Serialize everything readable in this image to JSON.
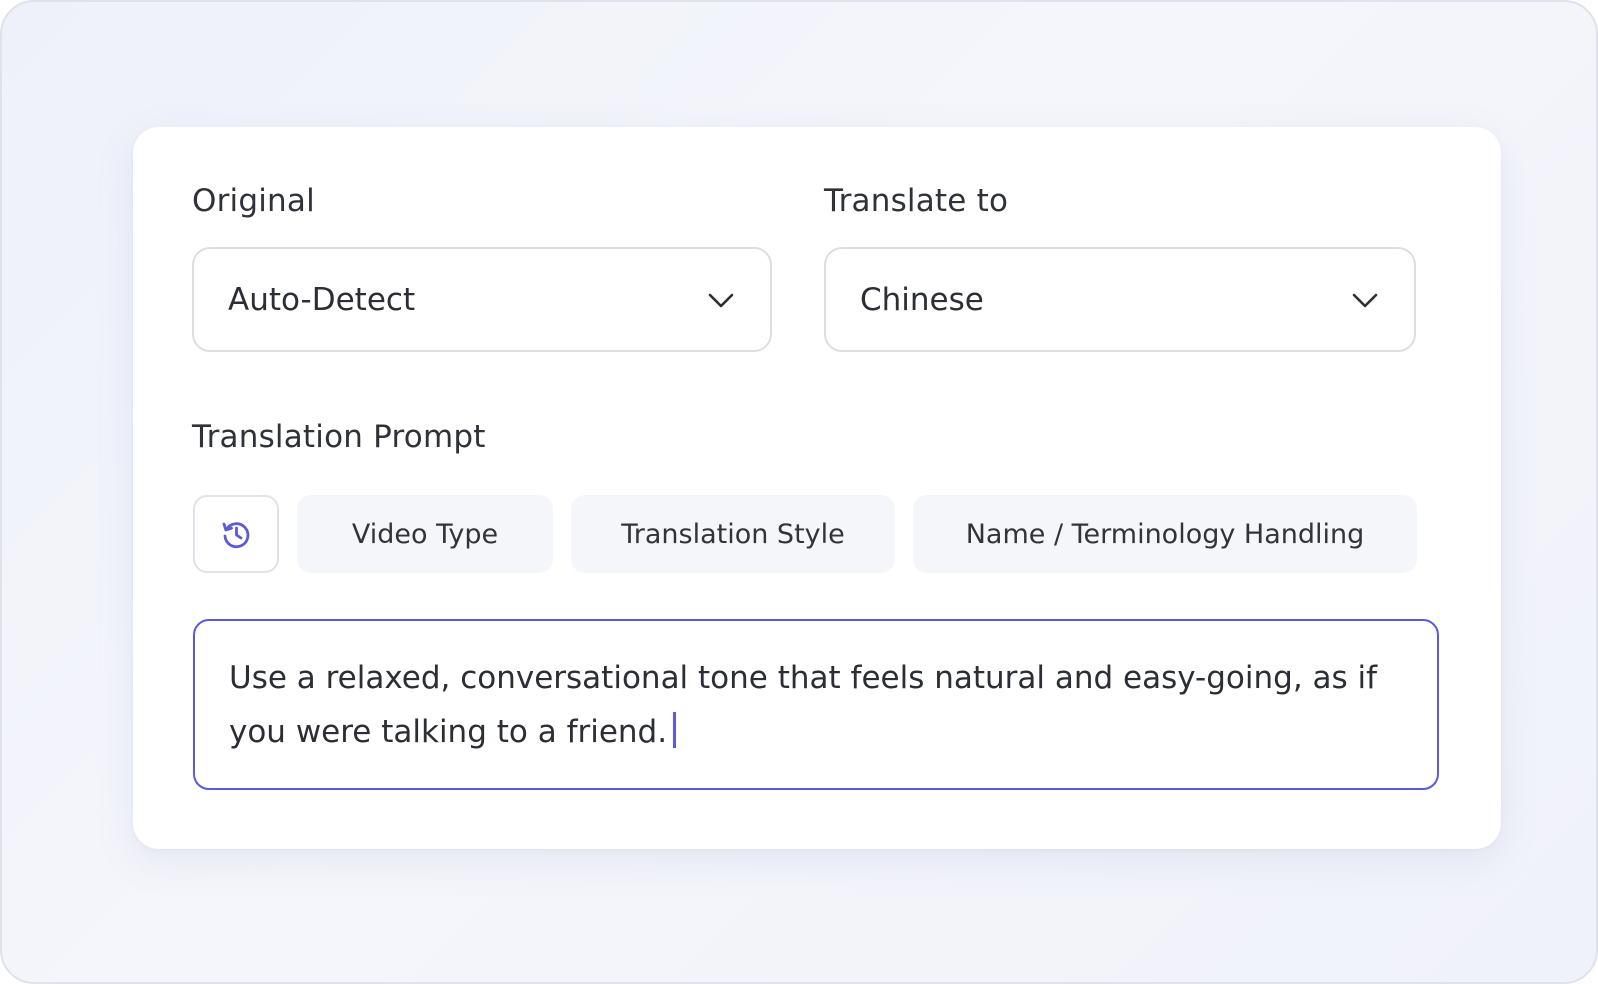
{
  "colors": {
    "accent": "#5b5bd6",
    "text": "#2c2e36",
    "chip_bg": "#f5f6fa",
    "border": "#dcdee4"
  },
  "original": {
    "label": "Original",
    "selected": "Auto-Detect",
    "icon": "chevron-down-icon"
  },
  "translate_to": {
    "label": "Translate to",
    "selected": "Chinese",
    "icon": "chevron-down-icon"
  },
  "prompt": {
    "label": "Translation Prompt",
    "history_icon": "history-icon",
    "chips": [
      "Video Type",
      "Translation Style",
      "Name / Terminology Handling"
    ],
    "text": "Use a relaxed, conversational tone that feels natural and easy-going, as if you were talking to a friend."
  }
}
